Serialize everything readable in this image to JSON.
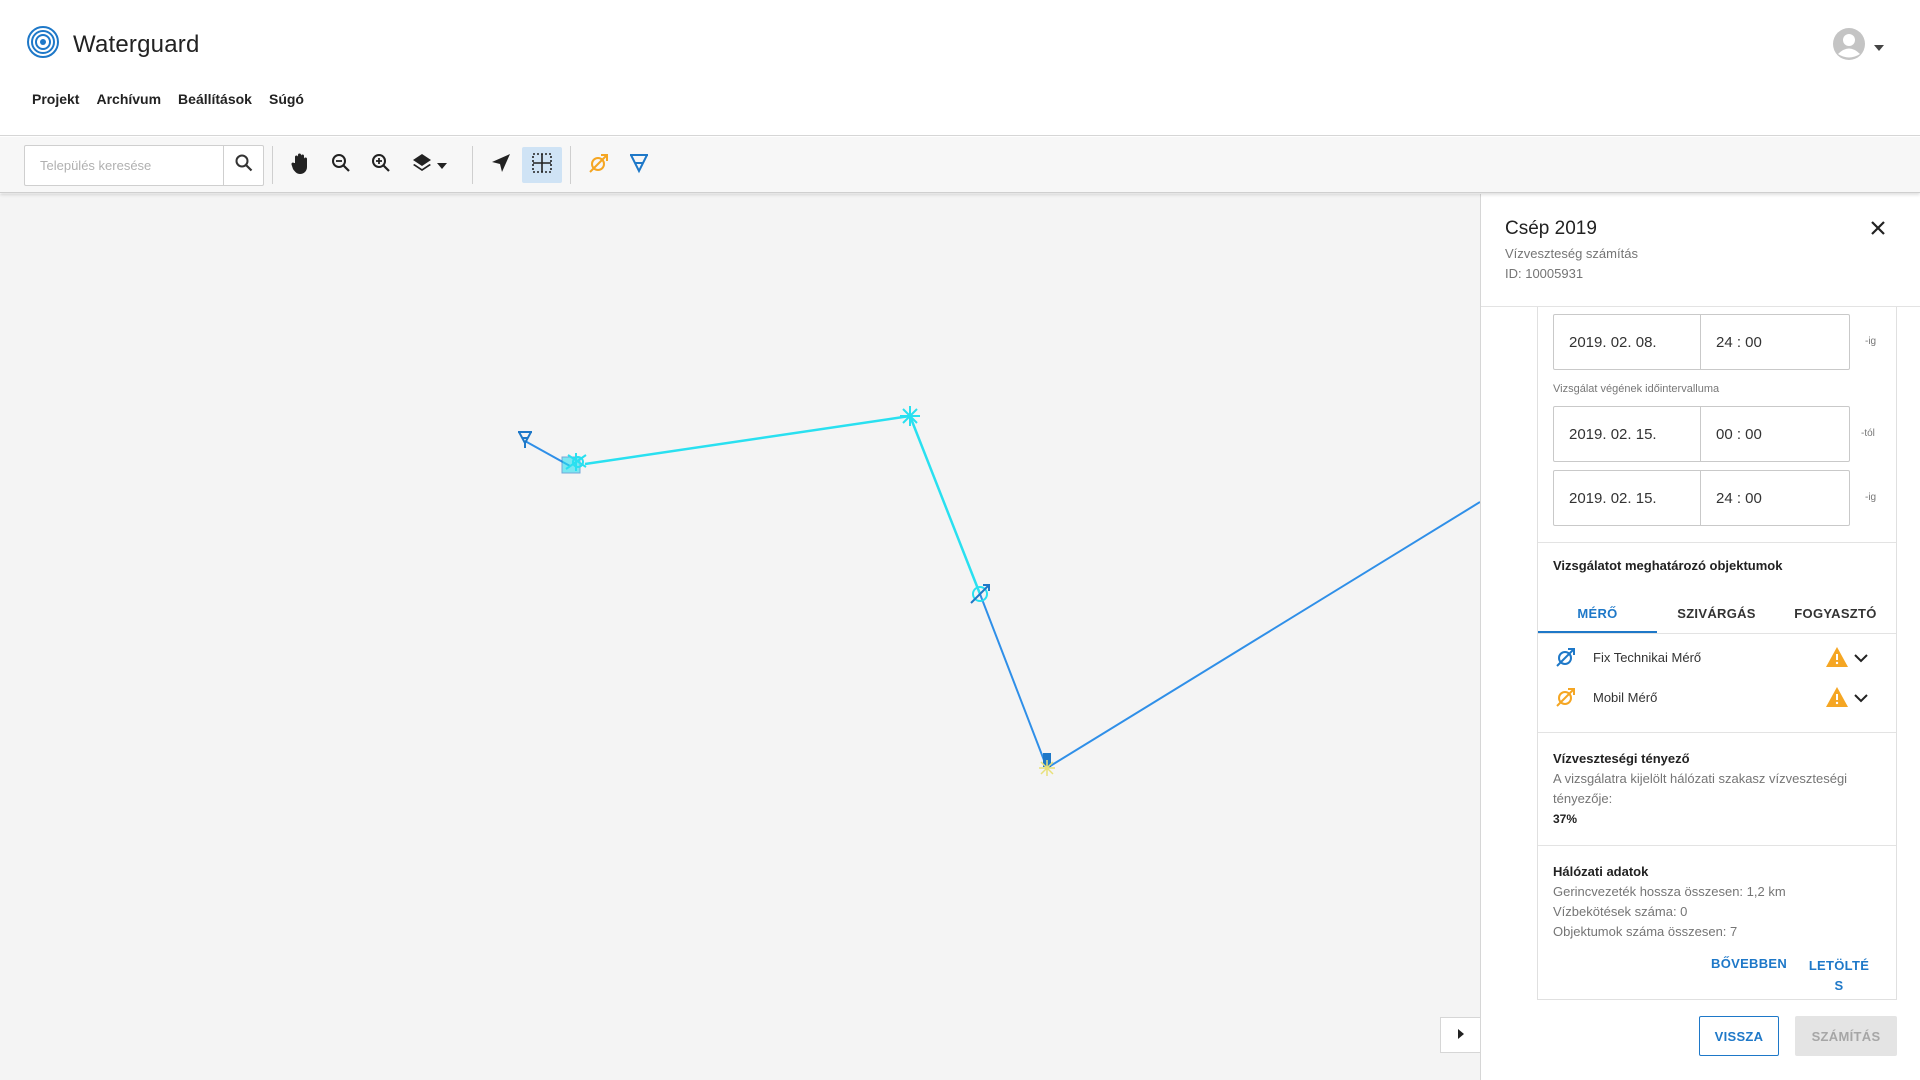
{
  "app": {
    "name": "Waterguard"
  },
  "nav": [
    "Projekt",
    "Archívum",
    "Beállítások",
    "Súgó"
  ],
  "search": {
    "placeholder": "Település keresése"
  },
  "toolbar": {
    "tools": [
      "pan-hand-icon",
      "zoom-out-icon",
      "zoom-in-icon",
      "layers-icon",
      "locate-arrow-icon",
      "grid-select-icon",
      "mobile-meter-icon",
      "fix-meter-icon"
    ],
    "active_tool": "grid-select-icon"
  },
  "colors": {
    "accent": "#1e78c8",
    "map_line_cyan": "#29e0f0",
    "map_line_blue": "#2f8fe8",
    "warning": "#f5a623",
    "mobile_meter": "#f5a623"
  },
  "panel": {
    "title": "Csép 2019",
    "subtitle": "Vízveszteség számítás",
    "id": "ID: 10005931",
    "range_start_to": {
      "date": "2019. 02. 08.",
      "time": "24 : 00",
      "suffix": "-ig"
    },
    "end_label": "Vizsgálat végének időintervalluma",
    "range_end_from": {
      "date": "2019. 02. 15.",
      "time": "00 : 00",
      "suffix": "-tól"
    },
    "range_end_to": {
      "date": "2019. 02. 15.",
      "time": "24 : 00",
      "suffix": "-ig"
    },
    "objects_title": "Vizsgálatot meghatározó objektumok",
    "tabs": [
      "MÉRŐ",
      "SZIVÁRGÁS",
      "FOGYASZTÓ"
    ],
    "active_tab": "MÉRŐ",
    "meters": [
      {
        "label": "Fix Technikai Mérő",
        "icon": "fix-meter-icon",
        "warning": true
      },
      {
        "label": "Mobil Mérő",
        "icon": "mobile-meter-icon",
        "warning": true
      }
    ],
    "loss_factor": {
      "title": "Vízveszteségi tényező",
      "text_line1": "A vizsgálatra kijelölt hálózati szakasz vízveszteségi",
      "text_line2": "tényezője:",
      "value": "37%"
    },
    "network": {
      "title": "Hálózati adatok",
      "line1": "Gerincvezeték hossza összesen: 1,2 km",
      "line2": "Vízbekötések száma: 0",
      "line3": "Objektumok száma összesen: 7"
    },
    "more_label": "BŐVEBBEN",
    "download_line1": "LETÖLTÉ",
    "download_line2": "S",
    "back_label": "VISSZA",
    "calc_label": "SZÁMÍTÁS"
  }
}
